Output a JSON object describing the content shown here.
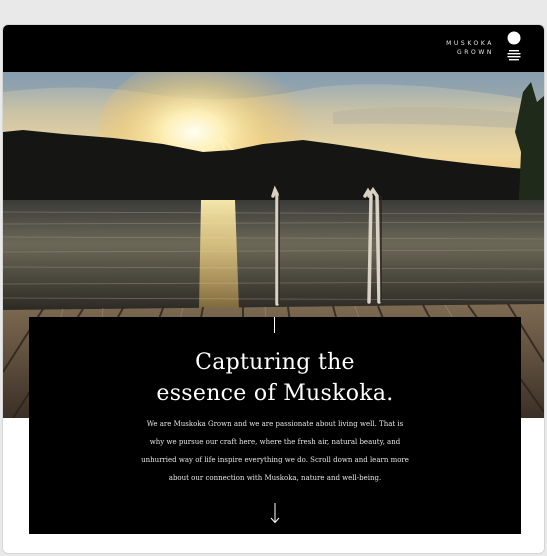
{
  "header": {
    "logo_line1": "MUSKOKA",
    "logo_line2": "GROWN",
    "logo_mark_icon": "sun-over-water-icon"
  },
  "hero": {
    "image": "sunset-dock-lake-photo"
  },
  "card": {
    "headline_line1": "Capturing  the",
    "headline_line2": "essence of Muskoka.",
    "body": "We are Muskoka Grown and we are passionate about living well. That is why we pursue our craft here, where the fresh air, natural beauty, and unhurried way of life inspire everything we do. Scroll down and learn more about our connection with Muskoka, nature and well-being.",
    "scroll_icon": "arrow-down-icon"
  },
  "colors": {
    "background": "#e9e9e9",
    "bar": "#000000",
    "text": "#ffffff"
  }
}
